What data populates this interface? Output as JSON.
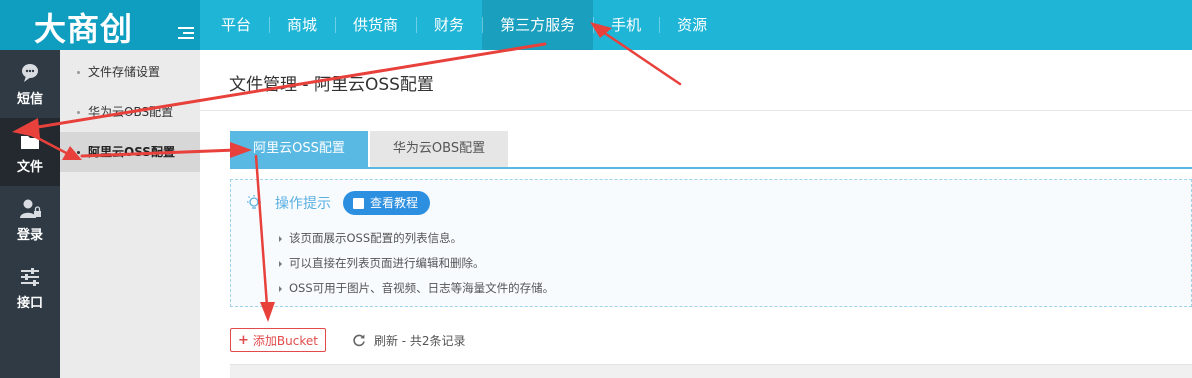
{
  "logo": {
    "text": "大商创"
  },
  "nav": {
    "items": [
      {
        "label": "平台"
      },
      {
        "label": "商城"
      },
      {
        "label": "供货商"
      },
      {
        "label": "财务"
      },
      {
        "label": "第三方服务",
        "active": true
      },
      {
        "label": "手机"
      },
      {
        "label": "资源"
      }
    ]
  },
  "sidebar": {
    "items": [
      {
        "label": "短信",
        "icon": "chat-bubble-icon"
      },
      {
        "label": "文件",
        "icon": "folder-icon",
        "active": true
      },
      {
        "label": "登录",
        "icon": "user-lock-icon"
      },
      {
        "label": "接口",
        "icon": "sliders-icon"
      }
    ]
  },
  "submenu": {
    "items": [
      {
        "label": "文件存储设置"
      },
      {
        "label": "华为云OBS配置"
      },
      {
        "label": "阿里云OSS配置",
        "active": true
      }
    ]
  },
  "main": {
    "title": "文件管理 - 阿里云OSS配置",
    "tabs": [
      {
        "label": "阿里云OSS配置",
        "active": true
      },
      {
        "label": "华为云OBS配置"
      }
    ],
    "tips": {
      "title": "操作提示",
      "tutorial_label": "查看教程",
      "items": [
        "该页面展示OSS配置的列表信息。",
        "可以直接在列表页面进行编辑和删除。",
        "OSS可用于图片、音视频、日志等海量文件的存储。"
      ]
    },
    "toolbar": {
      "add_label": "添加Bucket",
      "refresh_label": "刷新 - 共2条记录"
    }
  },
  "colors": {
    "topbar": "#1fb5d7",
    "sidebar": "#2f3a45",
    "tab_active": "#59b9e3",
    "tutorial_button": "#2c8fe0",
    "add_button": "#e24b4b",
    "annotation_arrow": "#e8413c"
  }
}
